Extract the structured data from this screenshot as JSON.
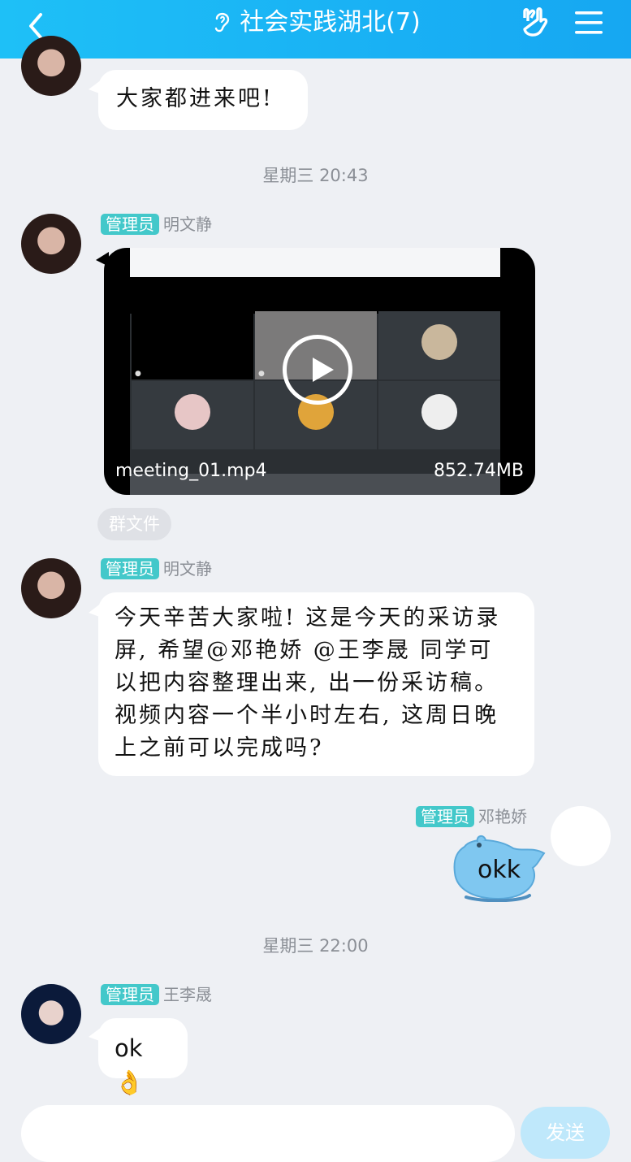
{
  "header": {
    "title": "社会实践湖北(7)",
    "accent": "#16a7f2"
  },
  "messages": [
    {
      "text": "大家都进来吧!"
    },
    {
      "time": "星期三 20:43"
    },
    {
      "badge": "管理员",
      "sender": "明文静",
      "video": {
        "filename": "meeting_01.mp4",
        "size": "852.74MB"
      },
      "tag": "群文件"
    },
    {
      "badge": "管理员",
      "sender": "明文静",
      "text_lines": [
        "今天辛苦大家啦! 这是今天的采访录",
        "屏, 希望@邓艳娇 @王李晟 同学可",
        "以把内容整理出来, 出一份采访稿。",
        "视频内容一个半小时左右, 这周日晚",
        "上之前可以完成吗?"
      ]
    },
    {
      "badge": "管理员",
      "sender": "邓艳娇",
      "text": "okk"
    },
    {
      "time": "星期三 22:00"
    },
    {
      "badge": "管理员",
      "sender": "王李晟",
      "text": "ok👌"
    }
  ],
  "input": {
    "send_label": "发送"
  }
}
